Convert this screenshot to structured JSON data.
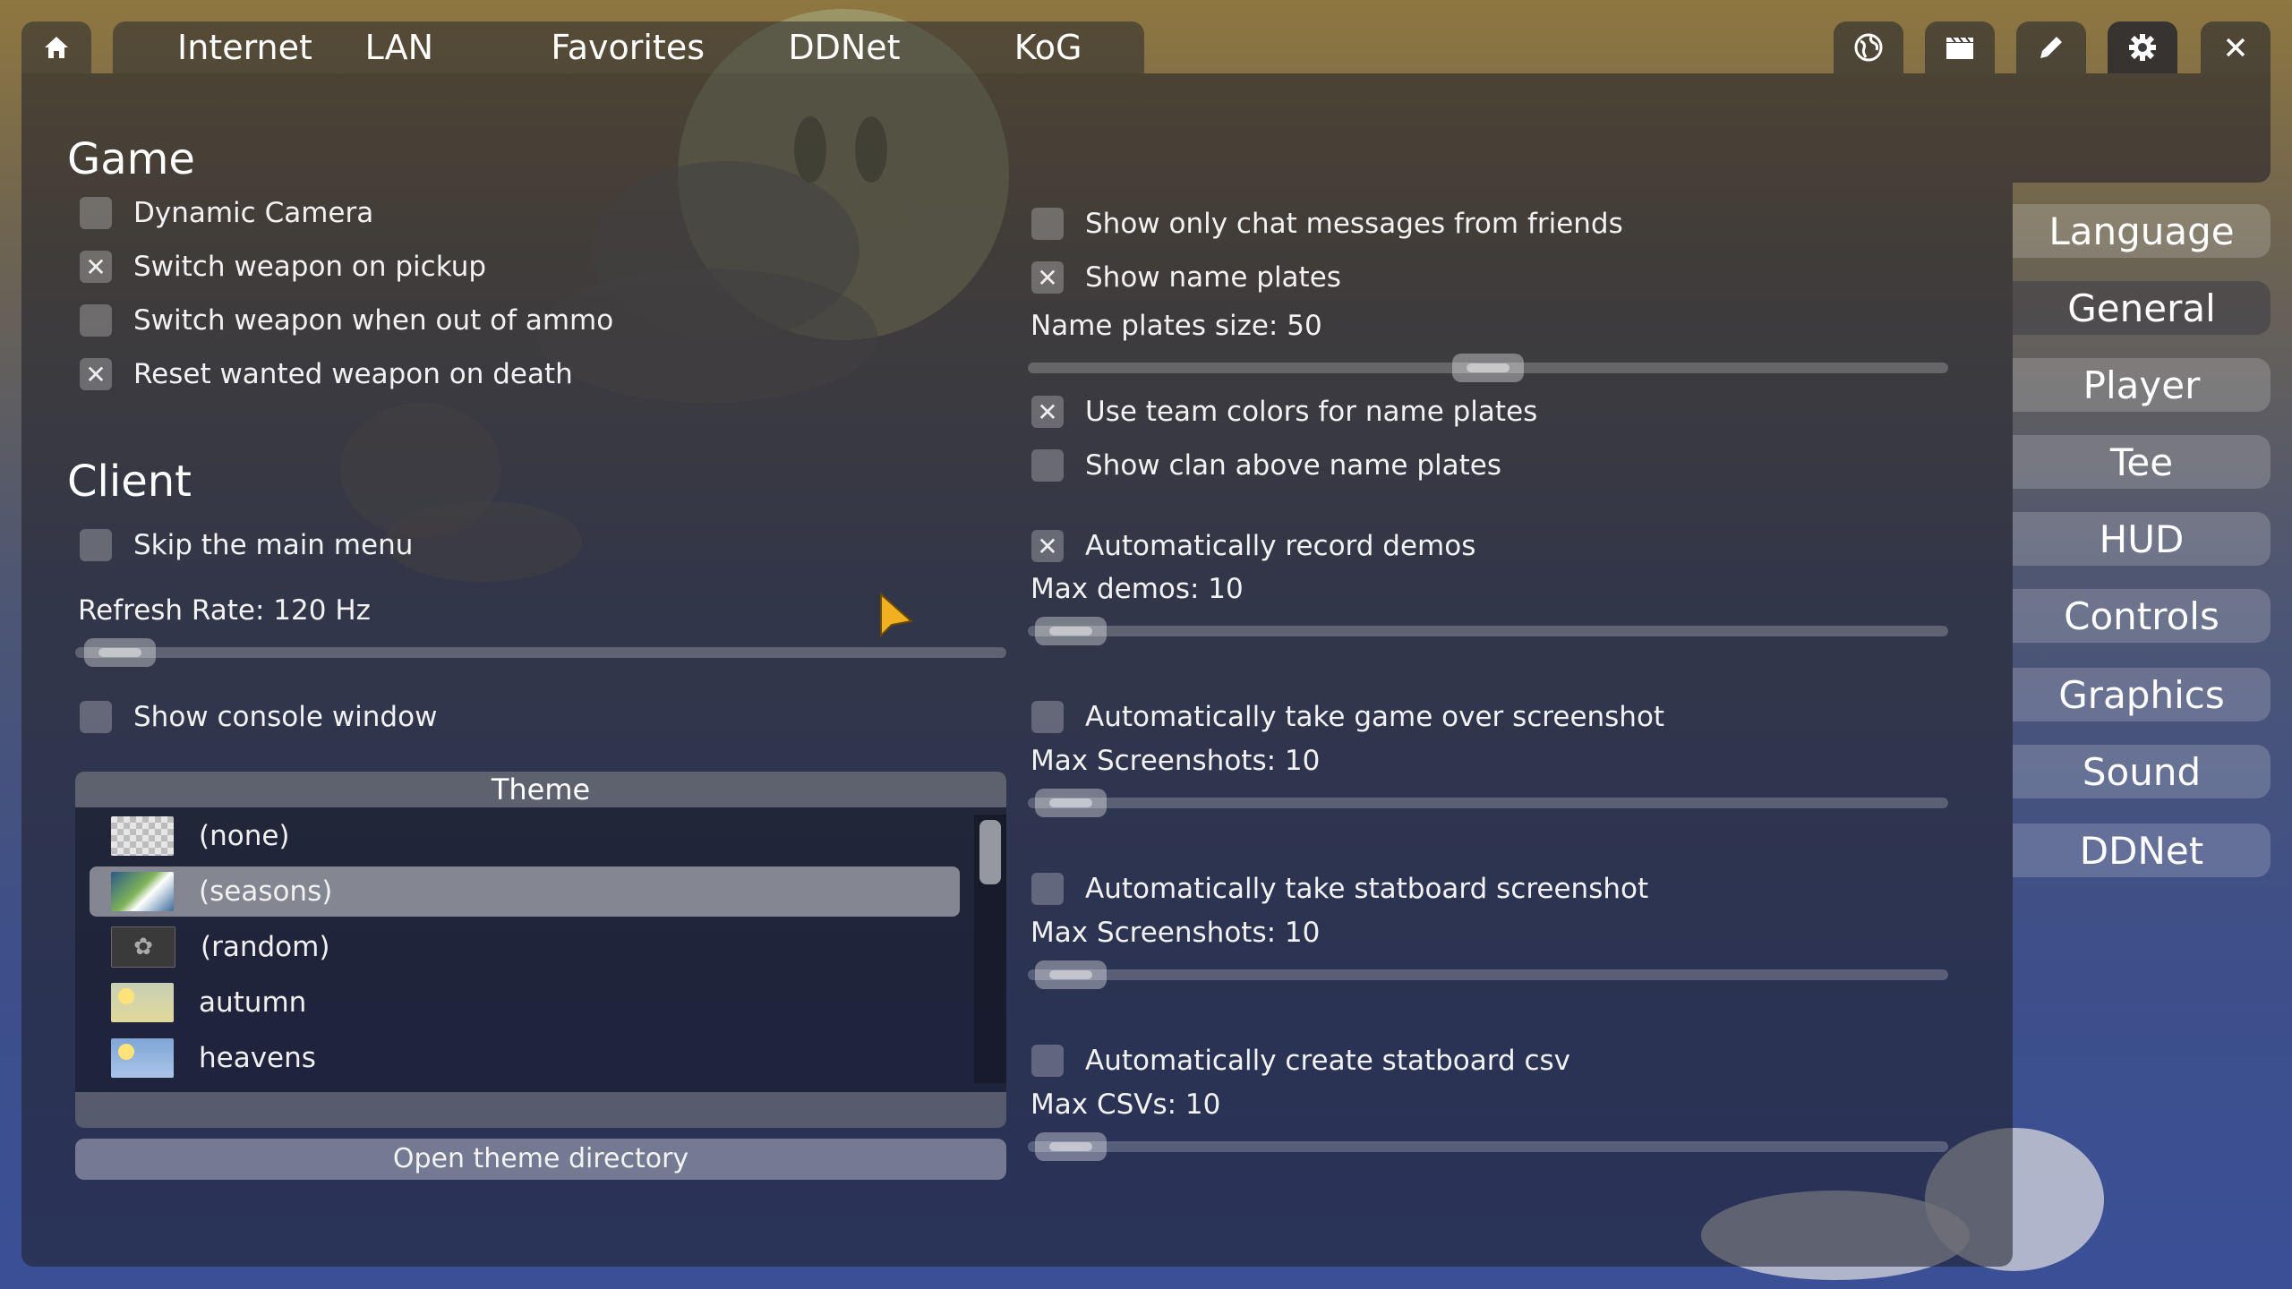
{
  "tabs": {
    "home_icon": "home-icon",
    "items": [
      "Internet",
      "LAN",
      "Favorites",
      "DDNet",
      "KoG"
    ]
  },
  "toolbar": {
    "icons": [
      "globe-icon",
      "clapperboard-icon",
      "pencil-icon",
      "gear-icon",
      "close-icon"
    ]
  },
  "game": {
    "title": "Game",
    "dynamic_camera": {
      "label": "Dynamic Camera",
      "checked": false
    },
    "switch_on_pickup": {
      "label": "Switch weapon on pickup",
      "checked": true
    },
    "switch_out_of_ammo": {
      "label": "Switch weapon when out of ammo",
      "checked": false
    },
    "reset_wanted": {
      "label": "Reset wanted weapon on death",
      "checked": true
    }
  },
  "client": {
    "title": "Client",
    "skip_menu": {
      "label": "Skip the main menu",
      "checked": false
    },
    "refresh_rate_label": "Refresh Rate: 120 Hz",
    "refresh_rate_value": 0.04,
    "console": {
      "label": "Show console window",
      "checked": false
    }
  },
  "theme": {
    "header": "Theme",
    "items": [
      "(none)",
      "(seasons)",
      "(random)",
      "autumn",
      "heavens"
    ],
    "selected": "(seasons)",
    "open_dir_label": "Open theme directory"
  },
  "chat": {
    "friends_only": {
      "label": "Show only chat messages from friends",
      "checked": false
    },
    "name_plates": {
      "label": "Show name plates",
      "checked": true
    },
    "name_plates_size_label": "Name plates size: 50",
    "name_plates_size_value": 0.5,
    "team_colors": {
      "label": "Use team colors for name plates",
      "checked": true
    },
    "clan_above": {
      "label": "Show clan above name plates",
      "checked": false
    }
  },
  "demos": {
    "auto_record": {
      "label": "Automatically record demos",
      "checked": true
    },
    "max_demos_label": "Max demos: 10",
    "auto_screenshot": {
      "label": "Automatically take game over screenshot",
      "checked": false
    },
    "max_screenshots_label": "Max Screenshots: 10",
    "auto_statboard": {
      "label": "Automatically take statboard screenshot",
      "checked": false
    },
    "max_statboard_label": "Max Screenshots: 10",
    "auto_csv": {
      "label": "Automatically create statboard csv",
      "checked": false
    },
    "max_csv_label": "Max CSVs: 10"
  },
  "sidebar": {
    "items": [
      "Language",
      "General",
      "Player",
      "Tee",
      "HUD",
      "Controls",
      "Graphics",
      "Sound",
      "DDNet"
    ],
    "active": "General"
  },
  "colors": {
    "panel": "#1e1e26",
    "accent_cursor": "#f0b020"
  }
}
